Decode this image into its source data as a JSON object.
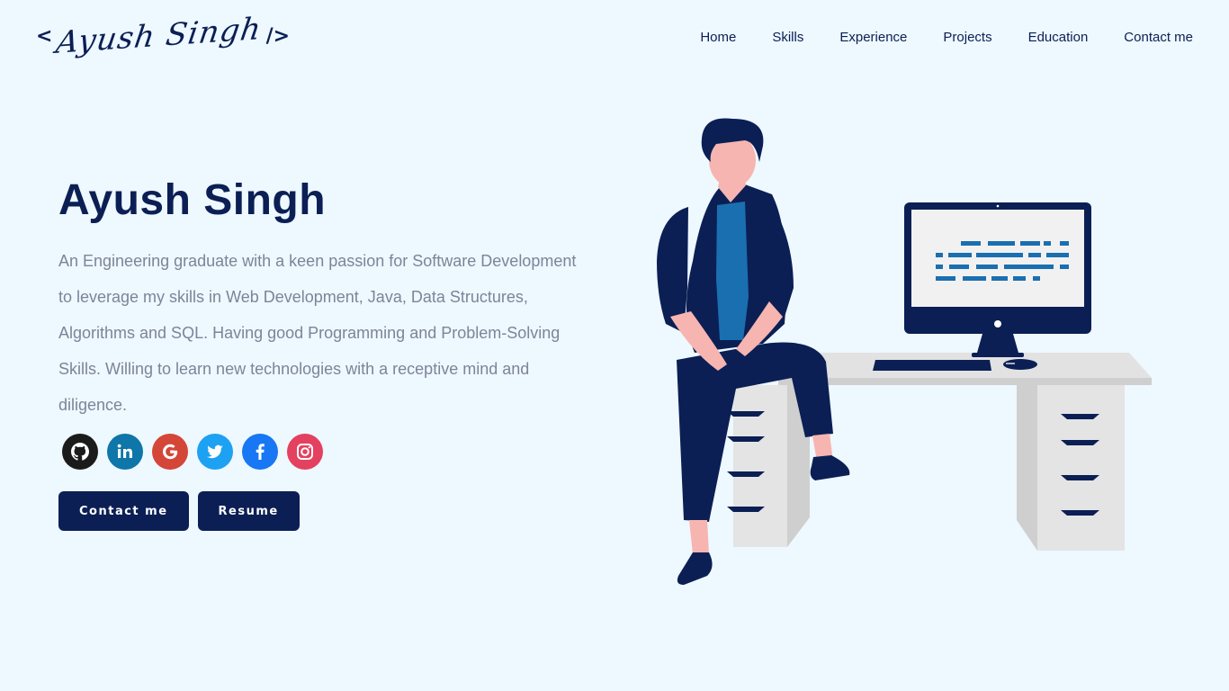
{
  "logo": {
    "open": "<",
    "name": "Ayush Singh",
    "close": "/>"
  },
  "nav": {
    "items": [
      {
        "label": "Home"
      },
      {
        "label": "Skills"
      },
      {
        "label": "Experience"
      },
      {
        "label": "Projects"
      },
      {
        "label": "Education"
      },
      {
        "label": "Contact me"
      }
    ]
  },
  "hero": {
    "name": "Ayush Singh",
    "bio": "An Engineering graduate with a keen passion for Software Development to leverage my skills in Web Development, Java, Data Structures, Algorithms and SQL. Having good Programming and Problem-Solving Skills. Willing to learn new technologies with a receptive mind and diligence.",
    "contact_label": "Contact me",
    "resume_label": "Resume"
  },
  "socials": [
    {
      "icon": "github-icon",
      "color": "#1b1b1b"
    },
    {
      "icon": "linkedin-icon",
      "color": "#0e76a8"
    },
    {
      "icon": "google-icon",
      "color": "#d44638"
    },
    {
      "icon": "twitter-icon",
      "color": "#1da1f2"
    },
    {
      "icon": "facebook-icon",
      "color": "#1877f2"
    },
    {
      "icon": "instagram-icon",
      "color": "#e4405f"
    }
  ],
  "colors": {
    "background": "#eef8ff",
    "primary": "#0b1f54",
    "body_text": "#7d8499"
  }
}
